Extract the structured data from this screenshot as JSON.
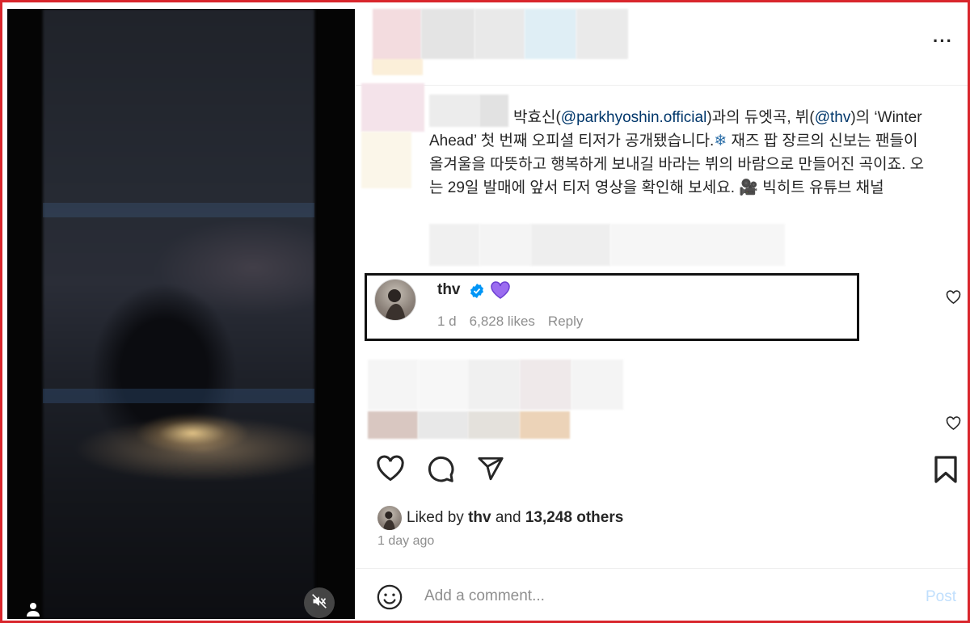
{
  "colors": {
    "frame": "#d9262c",
    "accent": "#0095f6",
    "mention": "#00376b",
    "secondary": "#8e8e8e",
    "heart_purple": "#8b5cf6"
  },
  "header": {
    "more_icon": "more-options-icon",
    "more_label": "···"
  },
  "caption": {
    "p1": "박효신(",
    "m1": "@parkhyoshin.official",
    "p2": ")과의 듀엣곡, 뷔(",
    "m2": "@thv",
    "p3": ")의 ‘Winter Ahead’ 첫 번째 오피셜 티저가 공개됐습니다.",
    "emoji1": "❄",
    "p4": " 재즈 팝 장르의 신보는 팬들이 올겨울을 따뜻하고 행복하게 보내길 바라는 뷔의 바람으로 만들어진 곡이죠. 오는 29일 발매에 앞서 티저 영상을 확인해 보세요. ",
    "emoji2": "🎥",
    "p5": " 빅히트 유튜브 채널"
  },
  "highlighted_comment": {
    "username": "thv",
    "time": "1 d",
    "likes": "6,828 likes",
    "reply": "Reply"
  },
  "post_actions": {
    "icons": [
      "heart-icon",
      "comment-icon",
      "share-icon",
      "bookmark-icon"
    ]
  },
  "likes": {
    "prefix": "Liked by",
    "user": "thv",
    "and": "and",
    "others": "13,248 others"
  },
  "timestamp": "1 day ago",
  "comment_bar": {
    "placeholder": "Add a comment...",
    "post": "Post"
  }
}
